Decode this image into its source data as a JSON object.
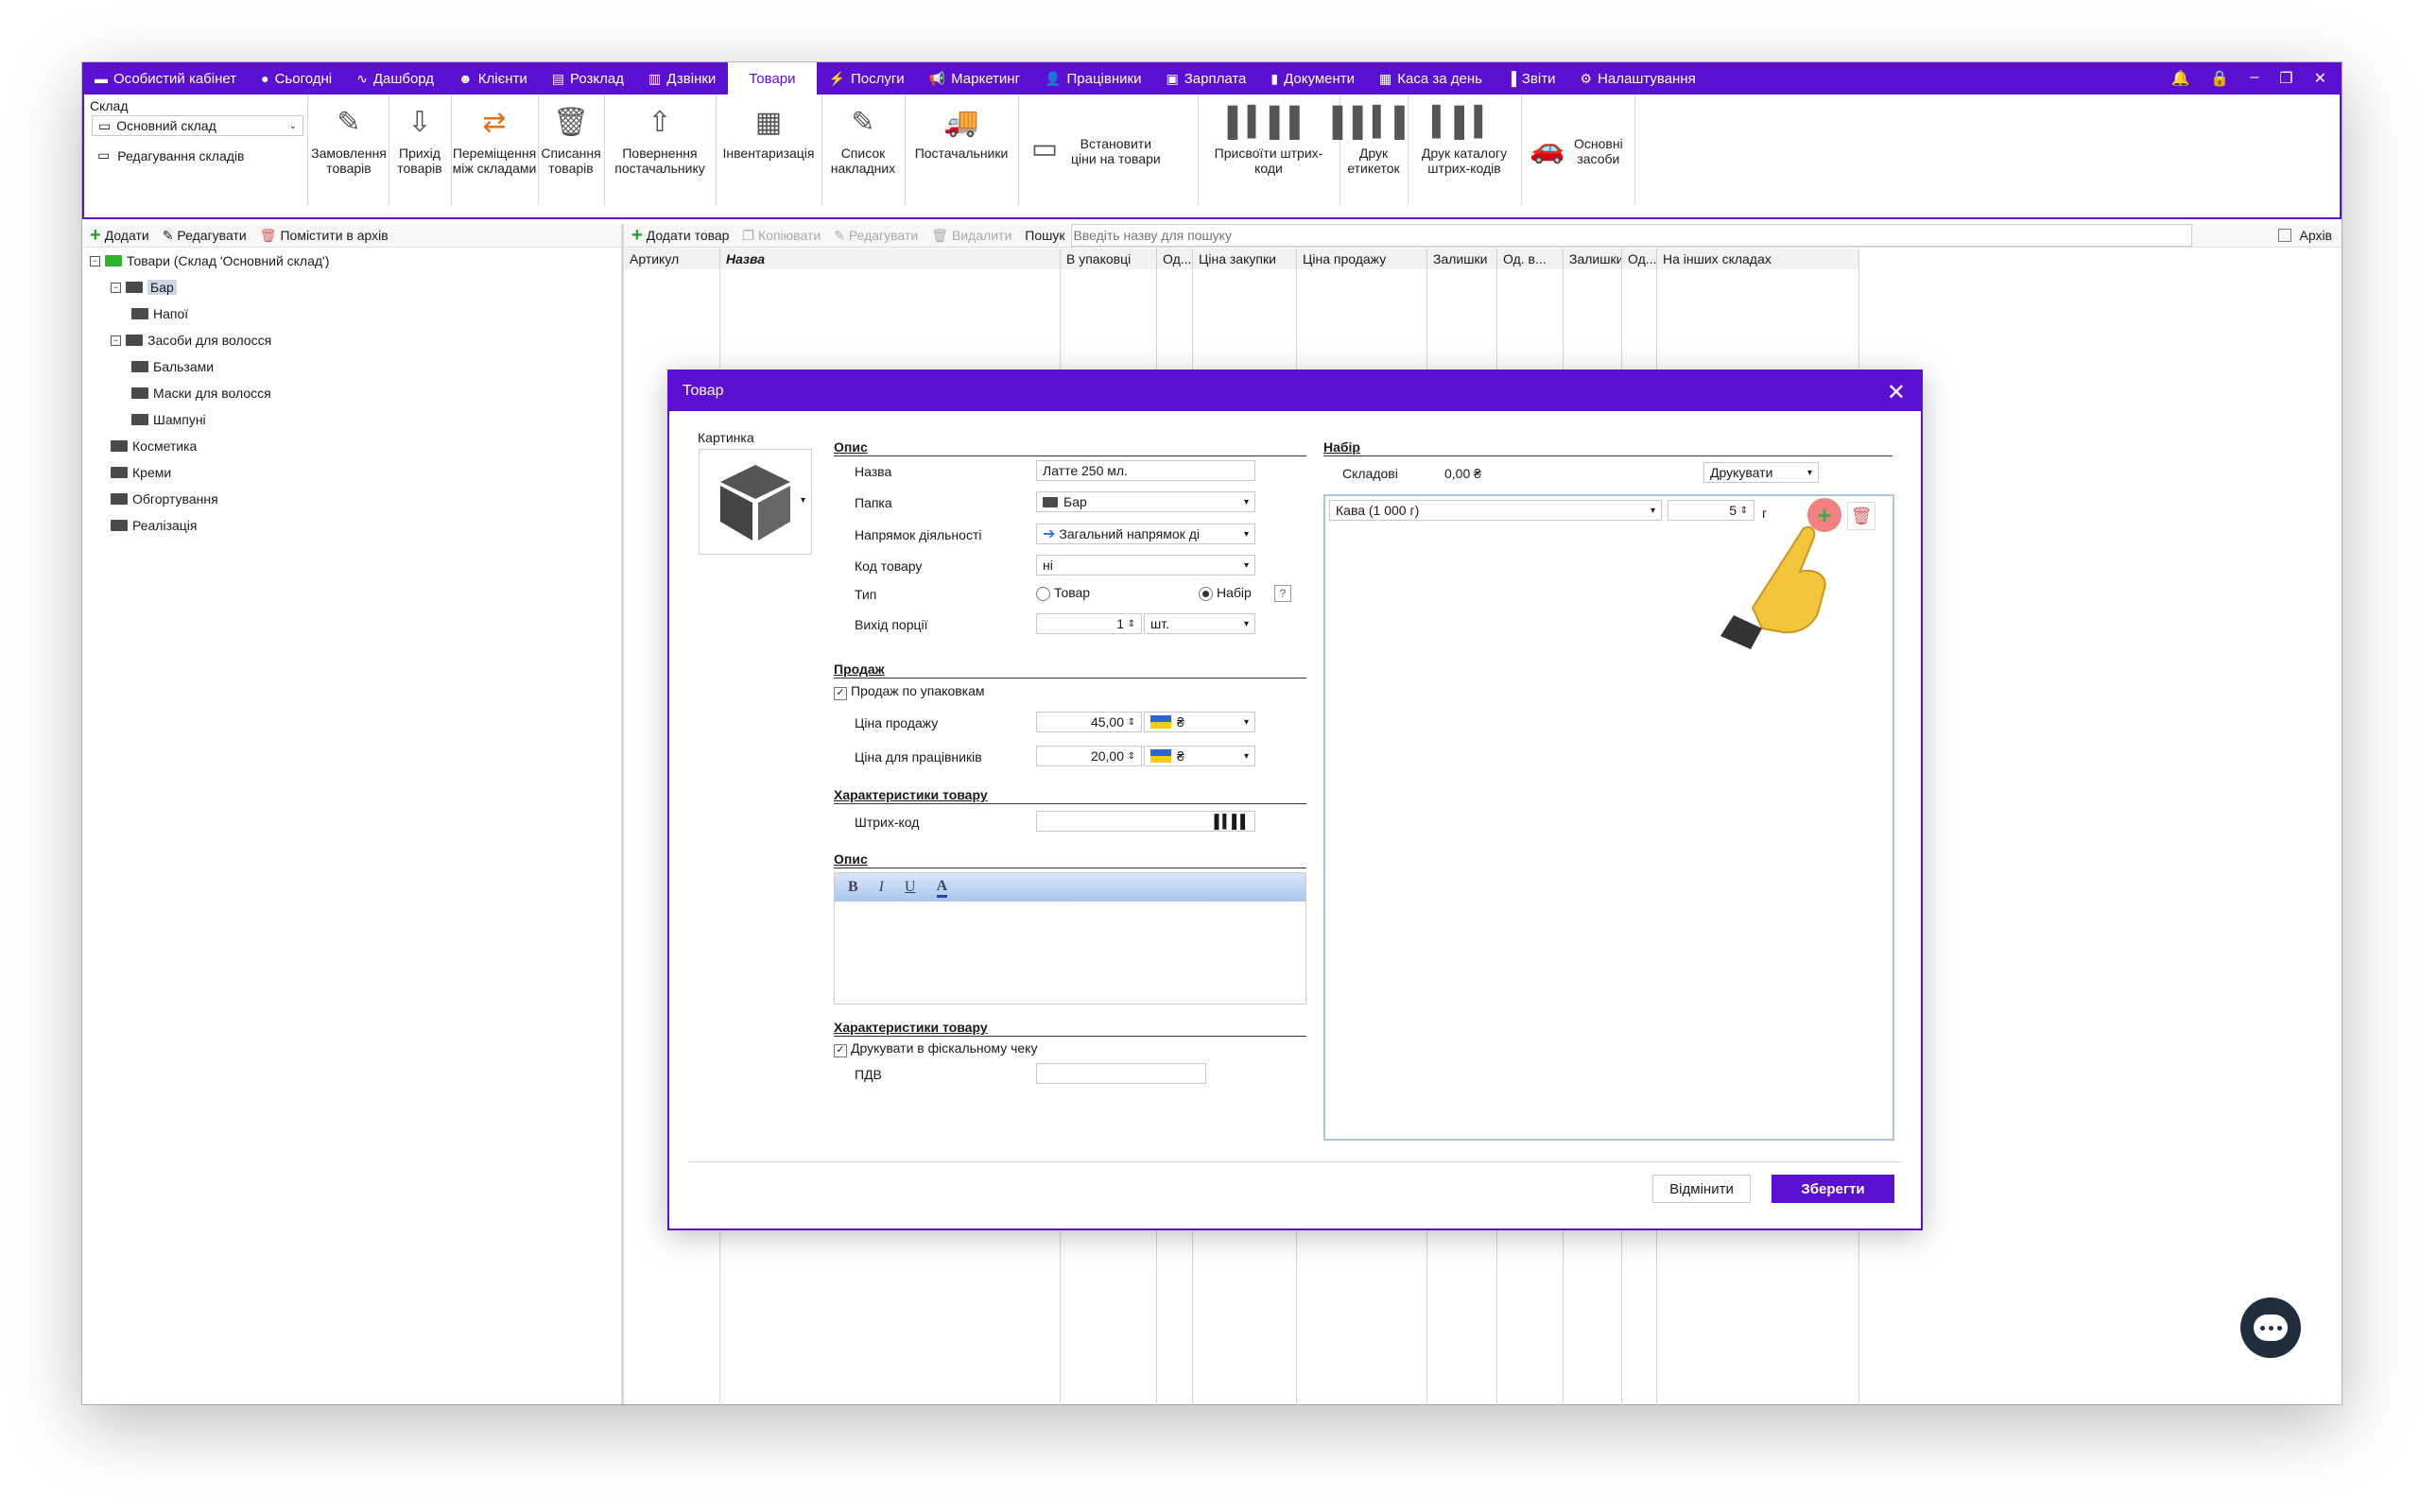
{
  "topbar": {
    "items": [
      {
        "label": "Особистий кабінет",
        "icon": "personal-cabinet-icon",
        "glyph": "▬"
      },
      {
        "label": "Сьогодні",
        "icon": "today-icon",
        "glyph": "●"
      },
      {
        "label": "Дашборд",
        "icon": "dashboard-icon",
        "glyph": "∿"
      },
      {
        "label": "Клієнти",
        "icon": "clients-icon",
        "glyph": "☻"
      },
      {
        "label": "Розклад",
        "icon": "schedule-icon",
        "glyph": "▤"
      },
      {
        "label": "Дзвінки",
        "icon": "calls-icon",
        "glyph": "▥"
      },
      {
        "label": "Товари",
        "icon": "",
        "glyph": ""
      },
      {
        "label": "Послуги",
        "icon": "services-icon",
        "glyph": "⚡"
      },
      {
        "label": "Маркетинг",
        "icon": "marketing-icon",
        "glyph": "📢"
      },
      {
        "label": "Працівники",
        "icon": "employees-icon",
        "glyph": "👤"
      },
      {
        "label": "Зарплата",
        "icon": "salary-icon",
        "glyph": "▣"
      },
      {
        "label": "Документи",
        "icon": "documents-icon",
        "glyph": "▮"
      },
      {
        "label": "Каса за день",
        "icon": "cashbox-icon",
        "glyph": "▦"
      },
      {
        "label": "Звіти",
        "icon": "reports-icon",
        "glyph": "▐"
      },
      {
        "label": "Налаштування",
        "icon": "settings-icon",
        "glyph": "⚙"
      }
    ],
    "active_index": 6
  },
  "ribbon": {
    "sklad_label": "Склад",
    "sklad_value": "Основний склад",
    "sklad_edit": "Редагування складів",
    "buttons": [
      {
        "label": "Замовлення\nтоварів",
        "icon": "pencil-icon"
      },
      {
        "label": "Прихід\nтоварів",
        "icon": "inbox-icon"
      },
      {
        "label": "Переміщення\nміж складами",
        "icon": "transfer-arrows-icon"
      },
      {
        "label": "Списання\nтоварів",
        "icon": "trash-bin-icon"
      },
      {
        "label": "Повернення\nпостачальнику",
        "icon": "outbox-icon"
      },
      {
        "label": "Інвентаризація",
        "icon": "calculator-icon"
      },
      {
        "label": "Список\nнакладних",
        "icon": "pencil-icon"
      },
      {
        "label": "Постачальники",
        "icon": "truck-icon"
      },
      {
        "label": "Встановити\nціни на товари",
        "icon": "money-icon"
      },
      {
        "label": "Присвоїти штрих-\nкоди",
        "icon": "barcode-icon"
      },
      {
        "label": "Друк\nетикеток",
        "icon": "barcode-print-icon"
      },
      {
        "label": "Друк каталогу\nштрих-кодів",
        "icon": "barcode-catalog-icon"
      },
      {
        "label": "Основні\nзасоби",
        "icon": "car-icon"
      }
    ]
  },
  "left": {
    "toolbar": {
      "add": "Додати",
      "edit": "Редагувати",
      "archive": "Помістити в архів"
    },
    "tree": [
      {
        "label": "Товари (Склад 'Основний склад')",
        "level": 0
      },
      {
        "label": "Бар",
        "level": 1
      },
      {
        "label": "Напої",
        "level": 2
      },
      {
        "label": "Засоби для волосся",
        "level": 1
      },
      {
        "label": "Бальзами",
        "level": 2
      },
      {
        "label": "Маски для волосся",
        "level": 2
      },
      {
        "label": "Шампуні",
        "level": 2
      },
      {
        "label": "Косметика",
        "level": 1
      },
      {
        "label": "Креми",
        "level": 1
      },
      {
        "label": "Обгортування",
        "level": 1
      },
      {
        "label": "Реалізація",
        "level": 1
      }
    ]
  },
  "right": {
    "toolbar": {
      "add": "Додати товар",
      "copy": "Копіювати",
      "edit": "Редагувати",
      "delete": "Видалити",
      "search_label": "Пошук",
      "search_placeholder": "Введіть назву для пошуку",
      "archive": "Архів"
    },
    "columns": [
      "Артикул",
      "Назва",
      "В упаковці",
      "Од...",
      "Ціна закупки",
      "Ціна продажу",
      "Залишки",
      "Од. в...",
      "Залишки",
      "Од...",
      "На інших складах"
    ]
  },
  "modal": {
    "title": "Товар",
    "picture_label": "Картинка",
    "opis": {
      "section": "Опис",
      "name_label": "Назва",
      "name_value": "Латте 250 мл.",
      "folder_label": "Папка",
      "folder_value": "Бар",
      "direction_label": "Напрямок діяльності",
      "direction_value": "Загальний напрямок ді",
      "code_label": "Код товару",
      "code_value": "ні",
      "type_label": "Тип",
      "type_option1": "Товар",
      "type_option2": "Набір",
      "help": "?",
      "portion_label": "Вихід порції",
      "portion_value": "1",
      "portion_unit": "шт."
    },
    "prodazh": {
      "section": "Продаж",
      "by_pack": "Продаж по упаковкам",
      "price_label": "Ціна продажу",
      "price_value": "45,00",
      "price_currency": "₴",
      "emp_price_label": "Ціна для працівників",
      "emp_price_value": "20,00",
      "emp_currency": "₴"
    },
    "chars1": {
      "section": "Характеристики товару",
      "barcode_label": "Штрих-код"
    },
    "opis2": {
      "section": "Опис",
      "bold": "B",
      "italic": "I",
      "underline": "U",
      "color": "A"
    },
    "chars2": {
      "section": "Характеристики товару",
      "fiscal": "Друкувати в фіскальному чеку",
      "pdv_label": "ПДВ"
    },
    "nabir": {
      "section": "Набір",
      "skladovi_label": "Складові",
      "skladovi_value": "0,00 ₴",
      "print_label": "Друкувати",
      "ingredient": "Кава (1 000 г)",
      "qty": "5",
      "unit": "г"
    },
    "cancel": "Відмінити",
    "save": "Зберегти"
  }
}
